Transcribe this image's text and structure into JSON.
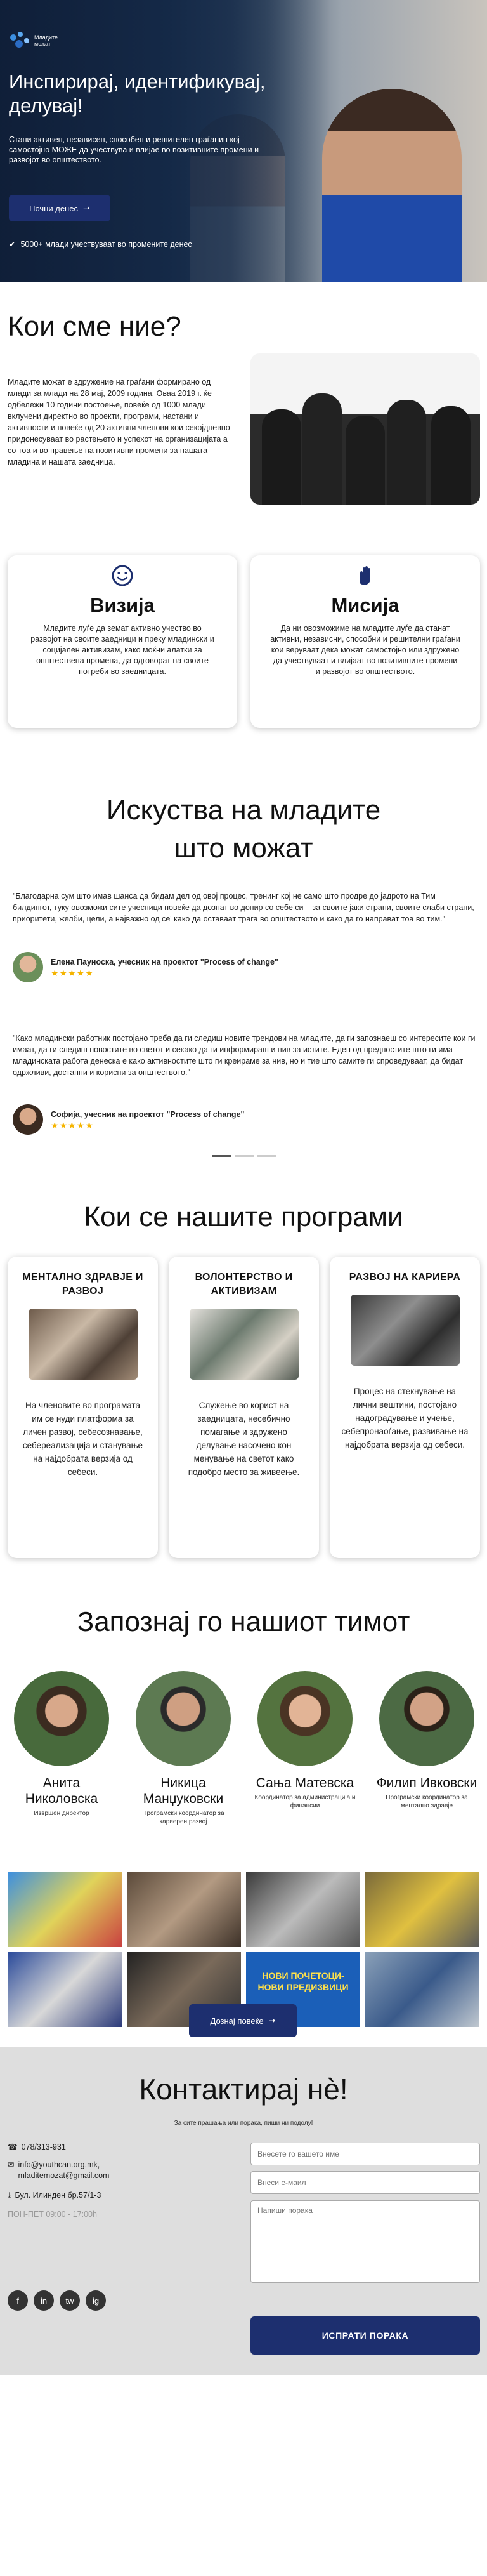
{
  "hero": {
    "logo_line1": "Младите",
    "logo_line2": "можат",
    "title": "Инспирирај, идентификувај, делувај!",
    "lead": "Стани активен, независен, способен и решителен граѓанин кој самостојно МОЖЕ да учествува и влијае во позитивните промени и развојот во општеството.",
    "cta_label": "Почни денес",
    "stat": "5000+ млади учествуваат во промените денес"
  },
  "who": {
    "title": "Кои сме ние?",
    "text": "Младите можат е здружение на граѓани формирано од млади за млади на 28 мај, 2009 година. Оваа 2019 г. ќе одбележи 10 години постоење, повеќе од 1000 млади вклучени директно во проекти, програми, настани и активности и повеќе од 20 активни членови кои секојдневно придонесуваат во растењето и успехот на организацијата а со тоа и во правење на позитивни промени за нашата младина и нашата заедница."
  },
  "vision": {
    "title": "Визија",
    "text": "Младите луѓе да земат активно учество во развојот на своите заедници и преку младински и социјален активизам, како моќни алатки за општествена промена, да одговорат на своите потреби во заедницата."
  },
  "mission": {
    "title": "Мисија",
    "text": "Да ни овозможиме на младите луѓе да станат активни, независни, способни и решителни граѓани кои веруваат дека можат самостојно или здружено да учествуваат и влијаат во позитивните промени и развојот во општеството."
  },
  "testimonials": {
    "title": "Искуства на младите што можат",
    "items": [
      {
        "quote": "\"Благодарна сум што имав шанса да бидам дел од овој процес, тренинг кој не само што продре до јадрото на Тим билдингот, туку овозможи сите учесници повеќе да дознат во допир со себе си – за своите јаки страни, своите слаби страни, приоритети, желби, цели, а најважно од се' како да оставаат трага во општеството и како да го направат тоа во тим.\"",
        "author": "Елена Пауноска, учесник на проектот \"Process of change\"",
        "stars": "★★★★★"
      },
      {
        "quote": "\"Како младински работник постојано треба да ги следиш новите трендови на младите, да ги запознаеш со интересите кои ги имаат, да ги следиш новостите во светот и секако да ги информираш и нив за истите. Еден од предностите што ги има младинската работа денеска е како активностите што ги креираме за нив, но и тие што самите ги спроведуваат, да бидат одржливи, достапни и корисни за општеството.\"",
        "author": "Софија, учесник на проектот \"Process of change\"",
        "stars": "★★★★★"
      }
    ]
  },
  "programs": {
    "title": "Кои се нашите програми",
    "items": [
      {
        "title": "МЕНТАЛНО ЗДРАВЈЕ И РАЗВОЈ",
        "text": "На членовите во програмата им се нуди платформа за личен развој, себесознавање, себереализација и станување на најдобрата верзија од себеси."
      },
      {
        "title": "ВОЛОНТЕРСТВО И АКТИВИЗАМ",
        "text": "Служење во корист на заедницата, несебично помагање и здружено делување насочено кон менување на светот како подобро место за живеење."
      },
      {
        "title": "РАЗВОЈ НА КАРИЕРА",
        "text": "Процес на стекнување на лични вештини, постојано надоградување и учење, себепронаоѓање, развивање на најдобрата верзија од себеси."
      }
    ]
  },
  "team": {
    "title": "Запознај го нашиот тимот",
    "members": [
      {
        "name": "Анита Николовска",
        "role": "Извршен директор"
      },
      {
        "name": "Никица Манџуковски",
        "role": "Програмски координатор за кариерен развој"
      },
      {
        "name": "Сања Матевска",
        "role": "Координатор за администрација и финансии"
      },
      {
        "name": "Филип Ивковски",
        "role": "Програмски координатор за ментално здравје"
      }
    ],
    "gallery_poster_text": "НОВИ ПОЧЕТОЦИ-НОВИ ПРЕДИЗВИЦИ",
    "more_label": "Дознај повеќе"
  },
  "contact": {
    "title": "Контактирај нѐ!",
    "subtitle": "За сите прашања или порака, пиши ни подолу!",
    "phone": "078/313-931",
    "email": "info@youthcan.org.mk, mladitemozat@gmail.com",
    "address": "Бул. Илинден бр.57/1-3",
    "hours": "ПОН-ПЕТ 09:00 - 17:00h",
    "name_placeholder": "Внесете го вашето име",
    "email_placeholder": "Внеси е-маил",
    "message_placeholder": "Напиши порака",
    "send_label": "ИСПРАТИ ПОРАКА",
    "social": [
      "f",
      "in",
      "tw",
      "ig"
    ]
  },
  "colors": {
    "accent": "#1d2f6f",
    "stars": "#f5b400",
    "contact_bg": "#dedede"
  }
}
